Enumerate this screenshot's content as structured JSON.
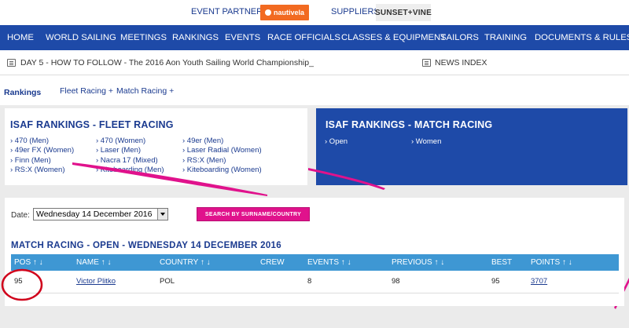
{
  "partners": {
    "event_partners_label": "EVENT PARTNERS",
    "nautivela_logo": "nautivela",
    "suppliers_label": "SUPPLIERS",
    "sunset_logo": "SUNSET+VINE"
  },
  "nav": {
    "items": [
      "HOME",
      "WORLD SAILING",
      "MEETINGS",
      "RANKINGS",
      "EVENTS",
      "RACE OFFICIALS",
      "CLASSES & EQUIPMENT",
      "SAILORS",
      "TRAINING",
      "DOCUMENTS & RULES"
    ]
  },
  "ticker": {
    "headline": "DAY 5 - HOW TO FOLLOW - The 2016 Aon Youth Sailing World Championship_",
    "news_index": "NEWS INDEX"
  },
  "subnav": {
    "title": "Rankings",
    "fleet_racing": "Fleet Racing +",
    "match_racing": "Match Racing +"
  },
  "fleet_card": {
    "title": "ISAF RANKINGS - FLEET RACING",
    "classes": [
      "› 470 (Men)",
      "› 470 (Women)",
      "› 49er (Men)",
      "› 49er FX (Women)",
      "› Laser (Men)",
      "› Laser Radial (Women)",
      "› Finn (Men)",
      "› Nacra 17 (Mixed)",
      "› RS:X (Men)",
      "› RS:X (Women)",
      "› Kiteboarding (Men)",
      "› Kiteboarding (Women)"
    ]
  },
  "match_card": {
    "title": "ISAF RANKINGS - MATCH RACING",
    "classes": [
      "› Open",
      "› Women"
    ]
  },
  "filter": {
    "date_label": "Date:",
    "date_value": "Wednesday 14 December 2016",
    "search_button": "SEARCH BY SURNAME/COUNTRY"
  },
  "results": {
    "title": "MATCH RACING - OPEN - WEDNESDAY 14 DECEMBER 2016",
    "headers": [
      "POS ↑ ↓",
      "NAME ↑ ↓",
      "COUNTRY ↑ ↓",
      "CREW",
      "EVENTS ↑ ↓",
      "PREVIOUS ↑ ↓",
      "BEST",
      "POINTS ↑ ↓"
    ],
    "rows": [
      {
        "pos": "95",
        "name": "Victor Plitko",
        "country": "POL",
        "crew": "",
        "events": "8",
        "previous": "98",
        "best": "95",
        "points": "3707"
      }
    ]
  },
  "colors": {
    "nav_blue": "#1e4aa8",
    "header_blue": "#3e97d3",
    "accent_pink": "#e0128c",
    "annotation_red": "#d0021b"
  }
}
